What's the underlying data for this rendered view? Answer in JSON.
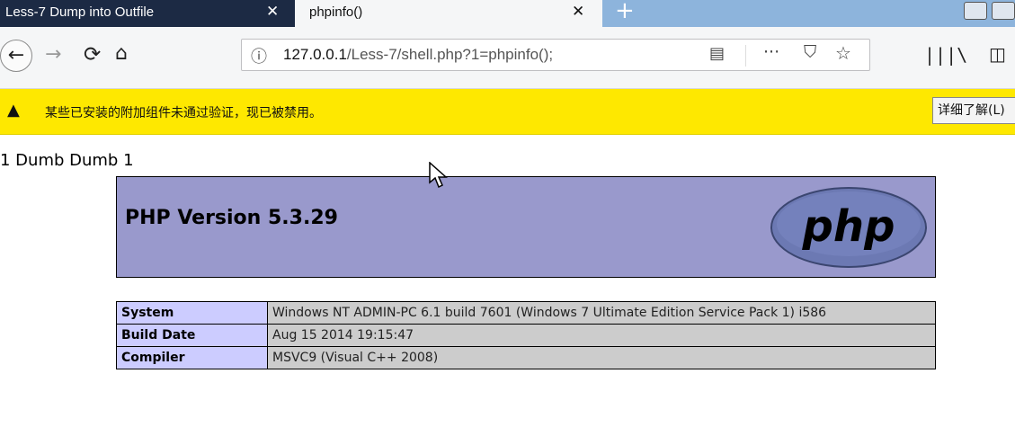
{
  "tabs": [
    {
      "title": "Less-7 Dump into Outfile",
      "close": "✕"
    },
    {
      "title": "phpinfo()",
      "close": "✕"
    }
  ],
  "new_tab_symbol": "+",
  "nav": {
    "back_icon": "arrow-left-icon",
    "forward_icon": "arrow-right-icon",
    "reload_icon": "reload-icon",
    "home_icon": "home-icon",
    "url_host": "127.0.0.1",
    "url_path": "/Less-7/shell.php?1=phpinfo();",
    "more_label": "···",
    "library_icon": "library-icon",
    "sidebar_icon": "sidebar-icon"
  },
  "notification": {
    "message": "某些已安装的附加组件未通过验证，现已被禁用。",
    "button_label": "详细了解(L)"
  },
  "page": {
    "dumb_text": "1 Dumb Dumb 1",
    "php_version": "PHP Version 5.3.29",
    "logo_text": "php",
    "rows": [
      {
        "key": "System",
        "value": "Windows NT ADMIN-PC 6.1 build 7601 (Windows 7 Ultimate Edition Service Pack 1) i586"
      },
      {
        "key": "Build Date",
        "value": "Aug 15 2014 19:15:47"
      },
      {
        "key": "Compiler",
        "value": "MSVC9 (Visual C++ 2008)"
      }
    ]
  },
  "colors": {
    "tab_inactive": "#1c2a44",
    "notification_bg": "#fee800",
    "php_header_bg": "#9999cc",
    "key_cell_bg": "#ccccff",
    "value_cell_bg": "#cccccc"
  }
}
